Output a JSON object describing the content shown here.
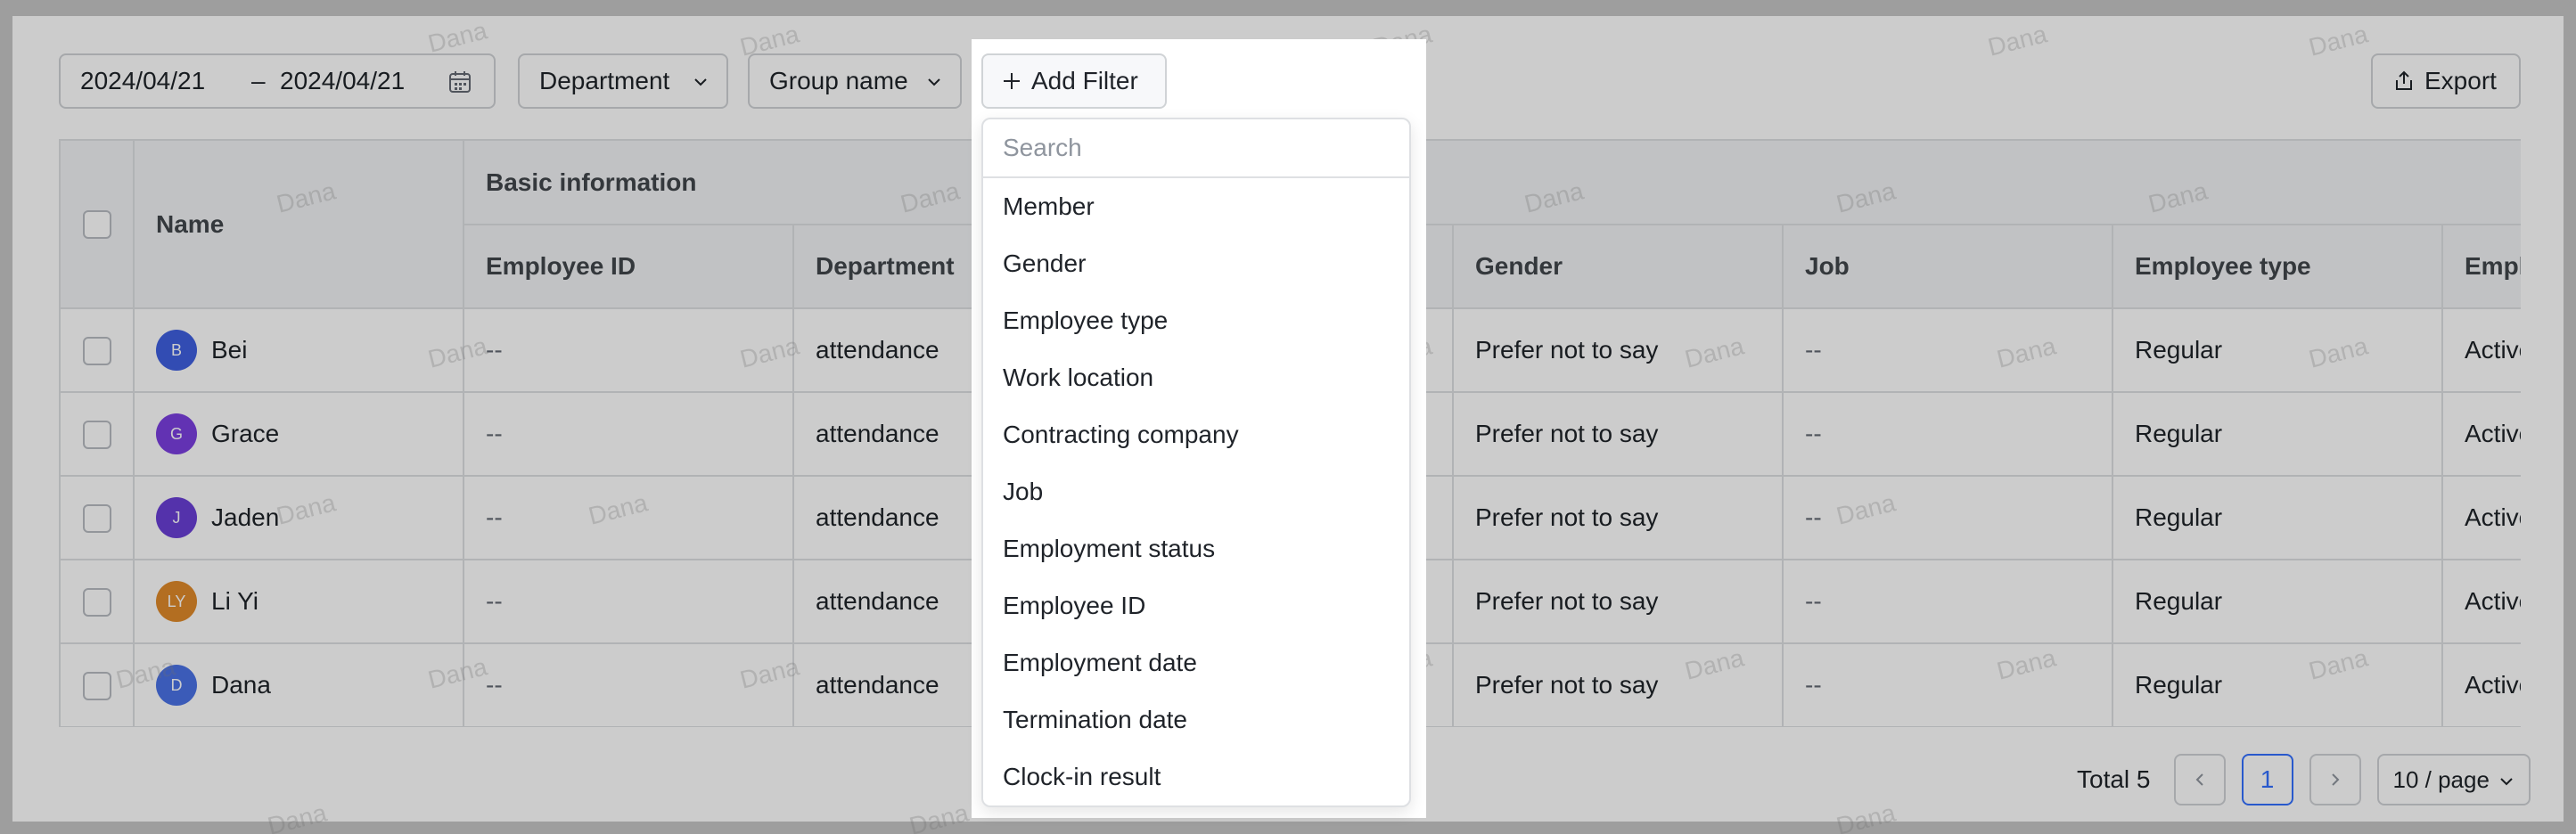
{
  "toolbar": {
    "date_start": "2024/04/21",
    "date_separator": "–",
    "date_end": "2024/04/21",
    "department_label": "Department",
    "group_label": "Group name",
    "add_filter_label": "Add Filter",
    "export_label": "Export"
  },
  "table": {
    "group_header": "Basic information",
    "name_header": "Name",
    "columns": [
      "Employee ID",
      "Department",
      "",
      "Gender",
      "Job",
      "Employee type",
      "Employment status"
    ],
    "rows": [
      {
        "initials": "B",
        "avatar_color": "#3f5fe0",
        "name": "Bei",
        "employee_id": "--",
        "department": "attendance",
        "gender": "Prefer not to say",
        "job": "--",
        "employee_type": "Regular",
        "status": "Active"
      },
      {
        "initials": "G",
        "avatar_color": "#7b3fe0",
        "name": "Grace",
        "employee_id": "--",
        "department": "attendance",
        "gender": "Prefer not to say",
        "job": "--",
        "employee_type": "Regular",
        "status": "Active"
      },
      {
        "initials": "J",
        "avatar_color": "#6a3fd6",
        "name": "Jaden",
        "employee_id": "--",
        "department": "attendance",
        "gender": "Prefer not to say",
        "job": "--",
        "employee_type": "Regular",
        "status": "Active"
      },
      {
        "initials": "LY",
        "avatar_color": "#e08a2a",
        "name": "Li Yi",
        "employee_id": "--",
        "department": "attendance",
        "gender": "Prefer not to say",
        "job": "--",
        "employee_type": "Regular",
        "status": "Active"
      },
      {
        "initials": "D",
        "avatar_color": "#4a72e6",
        "name": "Dana",
        "employee_id": "--",
        "department": "attendance",
        "gender": "Prefer not to say",
        "job": "--",
        "employee_type": "Regular",
        "status": "Active"
      }
    ]
  },
  "pagination": {
    "total_label": "Total 5",
    "current_page": "1",
    "page_size": "10 / page"
  },
  "dropdown": {
    "search_placeholder": "Search",
    "items": [
      "Member",
      "Gender",
      "Employee type",
      "Work location",
      "Contracting company",
      "Job",
      "Employment status",
      "Employee ID",
      "Employment date",
      "Termination date",
      "Clock-in result"
    ]
  },
  "watermark_text": "Dana"
}
